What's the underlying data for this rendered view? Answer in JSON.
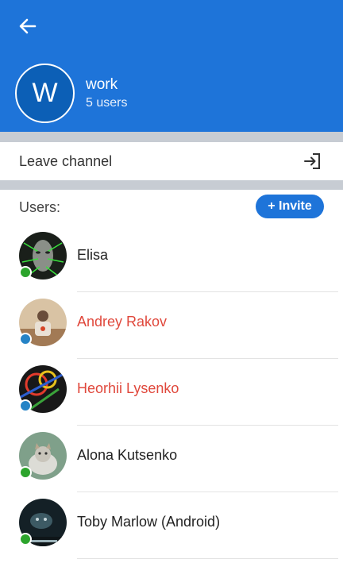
{
  "channel": {
    "initial": "W",
    "name": "work",
    "users_count": "5 users"
  },
  "actions": {
    "leave_label": "Leave channel"
  },
  "users_section": {
    "title": "Users:",
    "invite_label": "+ Invite"
  },
  "users": [
    {
      "name": "Elisa",
      "name_color": "#222222",
      "status_color": "#2ca42c"
    },
    {
      "name": "Andrey Rakov",
      "name_color": "#e0483c",
      "status_color": "#2583c6"
    },
    {
      "name": "Heorhii Lysenko",
      "name_color": "#e0483c",
      "status_color": "#2583c6"
    },
    {
      "name": "Alona Kutsenko",
      "name_color": "#222222",
      "status_color": "#2ca42c"
    },
    {
      "name": "Toby Marlow (Android)",
      "name_color": "#222222",
      "status_color": "#2ca42c"
    }
  ],
  "colors": {
    "header": "#1e74d9",
    "accent": "#1e74d9"
  },
  "icons": {
    "back": "arrow-left-icon",
    "leave": "exit-icon"
  }
}
